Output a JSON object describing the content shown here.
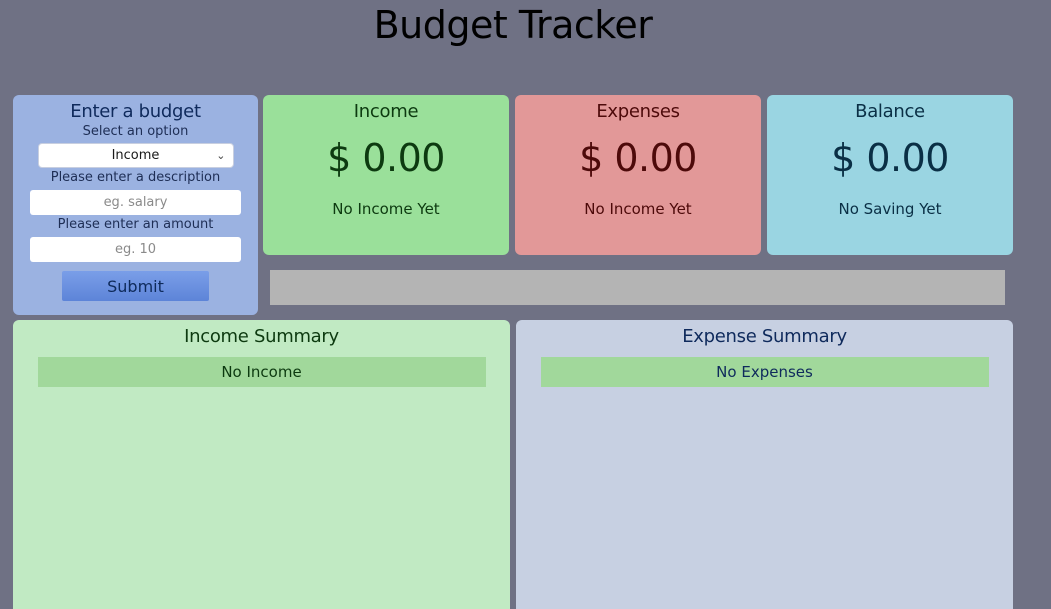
{
  "header": {
    "title": "Budget Tracker"
  },
  "form": {
    "heading": "Enter a budget",
    "option_label": "Select an option",
    "option_selected": "Income",
    "description_label": "Please enter a description",
    "description_placeholder": "eg. salary",
    "amount_label": "Please enter an amount",
    "amount_placeholder": "eg. 10",
    "submit_label": "Submit"
  },
  "cards": {
    "income": {
      "title": "Income",
      "amount": "$ 0.00",
      "note": "No Income Yet"
    },
    "expenses": {
      "title": "Expenses",
      "amount": "$ 0.00",
      "note": "No Income Yet"
    },
    "balance": {
      "title": "Balance",
      "amount": "$ 0.00",
      "note": "No Saving Yet"
    }
  },
  "progress": {
    "fraction": 0
  },
  "summaries": {
    "income": {
      "title": "Income Summary",
      "empty": "No Income"
    },
    "expense": {
      "title": "Expense Summary",
      "empty": "No Expenses"
    }
  },
  "colors": {
    "background": "#6f7184",
    "form": "#9bb2e1",
    "income": "#9ae09a",
    "expenses": "#e29898",
    "balance": "#9ad5e2",
    "income_summary": "#c1eac3",
    "expense_summary": "#c7d0e2",
    "empty_row": "#a1d89b"
  }
}
